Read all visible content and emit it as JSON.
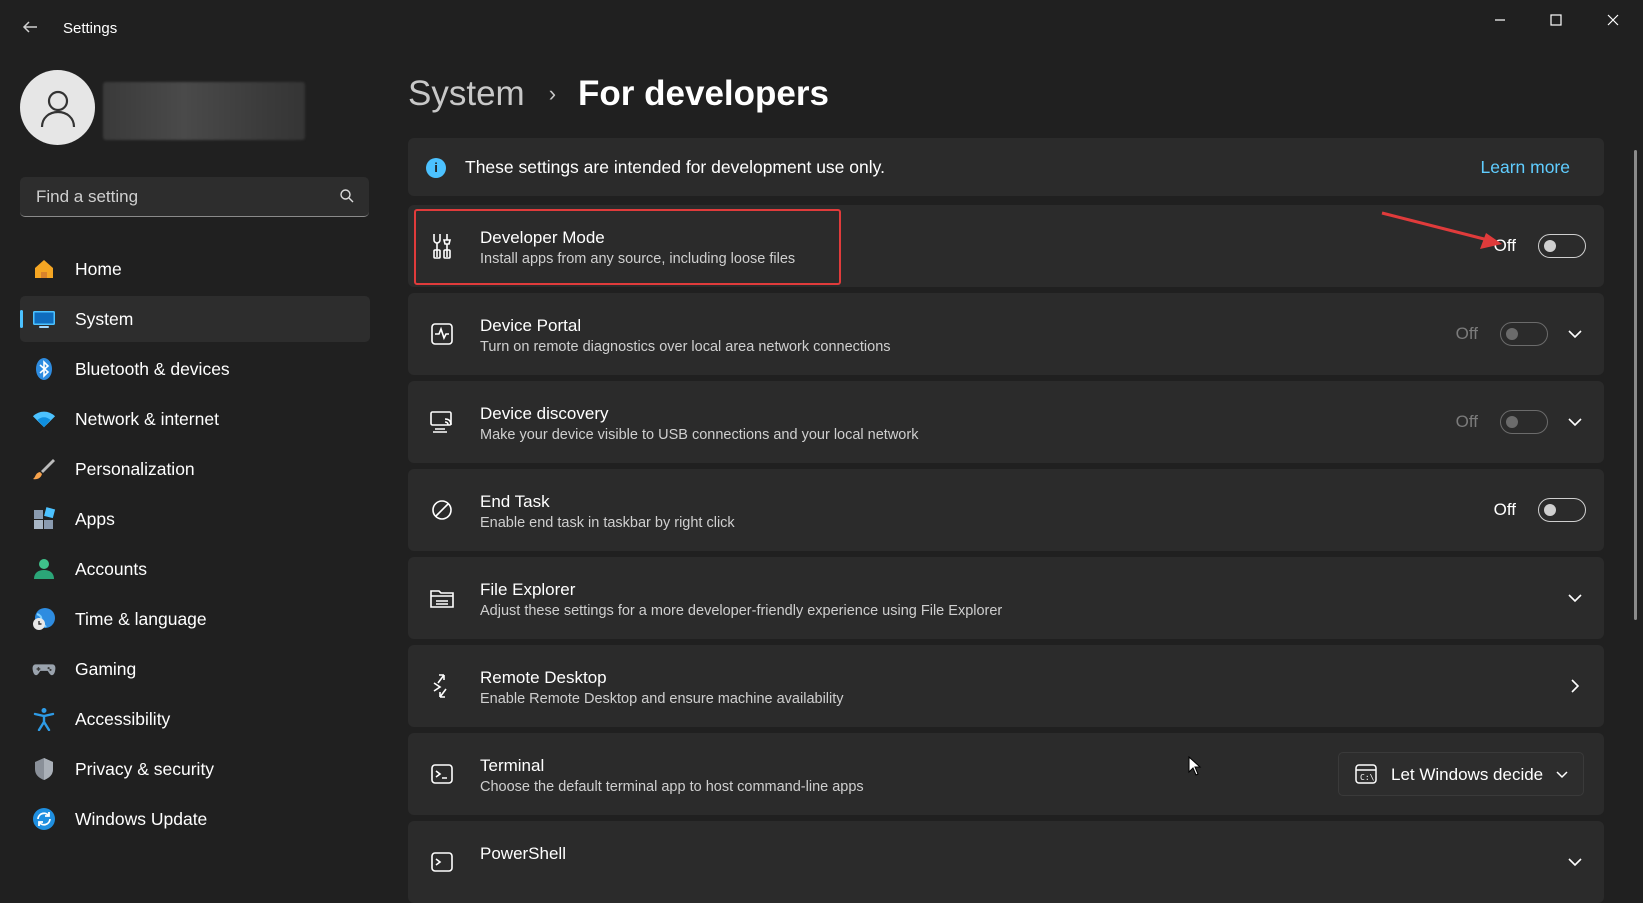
{
  "window": {
    "title": "Settings",
    "controls": [
      "minimize-icon",
      "maximize-icon",
      "close-icon"
    ]
  },
  "search": {
    "placeholder": "Find a setting"
  },
  "nav": {
    "items": [
      {
        "label": "Home",
        "icon": "home-icon",
        "active": false
      },
      {
        "label": "System",
        "icon": "system-icon",
        "active": true
      },
      {
        "label": "Bluetooth & devices",
        "icon": "bluetooth-icon",
        "active": false
      },
      {
        "label": "Network & internet",
        "icon": "wifi-icon",
        "active": false
      },
      {
        "label": "Personalization",
        "icon": "brush-icon",
        "active": false
      },
      {
        "label": "Apps",
        "icon": "apps-icon",
        "active": false
      },
      {
        "label": "Accounts",
        "icon": "account-icon",
        "active": false
      },
      {
        "label": "Time & language",
        "icon": "globe-clock-icon",
        "active": false
      },
      {
        "label": "Gaming",
        "icon": "gamepad-icon",
        "active": false
      },
      {
        "label": "Accessibility",
        "icon": "accessibility-icon",
        "active": false
      },
      {
        "label": "Privacy & security",
        "icon": "shield-icon",
        "active": false
      },
      {
        "label": "Windows Update",
        "icon": "update-icon",
        "active": false
      }
    ]
  },
  "breadcrumb": {
    "parent": "System",
    "separator": "›",
    "current": "For developers"
  },
  "info": {
    "text": "These settings are intended for development use only.",
    "link": "Learn more"
  },
  "settings": [
    {
      "title": "Developer Mode",
      "description": "Install apps from any source, including loose files",
      "state": "Off",
      "control": "toggle",
      "enabled": true,
      "highlighted": true
    },
    {
      "title": "Device Portal",
      "description": "Turn on remote diagnostics over local area network connections",
      "state": "Off",
      "control": "toggle-expand",
      "enabled": false
    },
    {
      "title": "Device discovery",
      "description": "Make your device visible to USB connections and your local network",
      "state": "Off",
      "control": "toggle-expand",
      "enabled": false
    },
    {
      "title": "End Task",
      "description": "Enable end task in taskbar by right click",
      "state": "Off",
      "control": "toggle",
      "enabled": true
    },
    {
      "title": "File Explorer",
      "description": "Adjust these settings for a more developer-friendly experience using File Explorer",
      "control": "expand"
    },
    {
      "title": "Remote Desktop",
      "description": "Enable Remote Desktop and ensure machine availability",
      "control": "navigate"
    },
    {
      "title": "Terminal",
      "description": "Choose the default terminal app to host command-line apps",
      "control": "dropdown",
      "dropdown_value": "Let Windows decide"
    },
    {
      "title": "PowerShell",
      "description": "",
      "control": "expand"
    }
  ],
  "colors": {
    "background": "#202020",
    "card": "#2b2b2b",
    "accent": "#4cc2ff",
    "link": "#60cdff",
    "annotation": "#e03b3b"
  }
}
